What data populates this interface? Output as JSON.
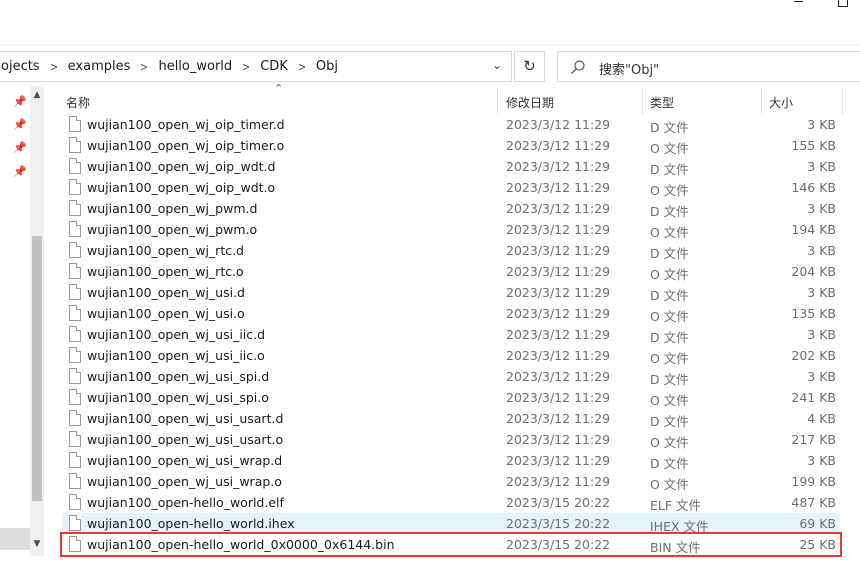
{
  "address": {
    "breadcrumbs": [
      "ojects",
      "examples",
      "hello_world",
      "CDK",
      "Obj"
    ]
  },
  "search": {
    "placeholder": "搜索\"Obj\""
  },
  "columns": {
    "name": "名称",
    "date": "修改日期",
    "type": "类型",
    "size": "大小"
  },
  "files": [
    {
      "name": "wujian100_open_wj_oip_timer.d",
      "date": "2023/3/12 11:29",
      "type": "D 文件",
      "size": "3 KB"
    },
    {
      "name": "wujian100_open_wj_oip_timer.o",
      "date": "2023/3/12 11:29",
      "type": "O 文件",
      "size": "155 KB"
    },
    {
      "name": "wujian100_open_wj_oip_wdt.d",
      "date": "2023/3/12 11:29",
      "type": "D 文件",
      "size": "3 KB"
    },
    {
      "name": "wujian100_open_wj_oip_wdt.o",
      "date": "2023/3/12 11:29",
      "type": "O 文件",
      "size": "146 KB"
    },
    {
      "name": "wujian100_open_wj_pwm.d",
      "date": "2023/3/12 11:29",
      "type": "D 文件",
      "size": "3 KB"
    },
    {
      "name": "wujian100_open_wj_pwm.o",
      "date": "2023/3/12 11:29",
      "type": "O 文件",
      "size": "194 KB"
    },
    {
      "name": "wujian100_open_wj_rtc.d",
      "date": "2023/3/12 11:29",
      "type": "D 文件",
      "size": "3 KB"
    },
    {
      "name": "wujian100_open_wj_rtc.o",
      "date": "2023/3/12 11:29",
      "type": "O 文件",
      "size": "204 KB"
    },
    {
      "name": "wujian100_open_wj_usi.d",
      "date": "2023/3/12 11:29",
      "type": "D 文件",
      "size": "3 KB"
    },
    {
      "name": "wujian100_open_wj_usi.o",
      "date": "2023/3/12 11:29",
      "type": "O 文件",
      "size": "135 KB"
    },
    {
      "name": "wujian100_open_wj_usi_iic.d",
      "date": "2023/3/12 11:29",
      "type": "D 文件",
      "size": "3 KB"
    },
    {
      "name": "wujian100_open_wj_usi_iic.o",
      "date": "2023/3/12 11:29",
      "type": "O 文件",
      "size": "202 KB"
    },
    {
      "name": "wujian100_open_wj_usi_spi.d",
      "date": "2023/3/12 11:29",
      "type": "D 文件",
      "size": "3 KB"
    },
    {
      "name": "wujian100_open_wj_usi_spi.o",
      "date": "2023/3/12 11:29",
      "type": "O 文件",
      "size": "241 KB"
    },
    {
      "name": "wujian100_open_wj_usi_usart.d",
      "date": "2023/3/12 11:29",
      "type": "D 文件",
      "size": "4 KB"
    },
    {
      "name": "wujian100_open_wj_usi_usart.o",
      "date": "2023/3/12 11:29",
      "type": "O 文件",
      "size": "217 KB"
    },
    {
      "name": "wujian100_open_wj_usi_wrap.d",
      "date": "2023/3/12 11:29",
      "type": "D 文件",
      "size": "3 KB"
    },
    {
      "name": "wujian100_open_wj_usi_wrap.o",
      "date": "2023/3/12 11:29",
      "type": "O 文件",
      "size": "199 KB"
    },
    {
      "name": "wujian100_open-hello_world.elf",
      "date": "2023/3/15 20:22",
      "type": "ELF 文件",
      "size": "487 KB"
    },
    {
      "name": "wujian100_open-hello_world.ihex",
      "date": "2023/3/15 20:22",
      "type": "IHEX 文件",
      "size": "69 KB"
    },
    {
      "name": "wujian100_open-hello_world_0x0000_0x6144.bin",
      "date": "2023/3/15 20:22",
      "type": "BIN 文件",
      "size": "25 KB"
    }
  ],
  "selected_index": 19,
  "highlighted_index": 20,
  "colors": {
    "selection": "#e5f3ff",
    "highlight_box": "#e53935"
  }
}
